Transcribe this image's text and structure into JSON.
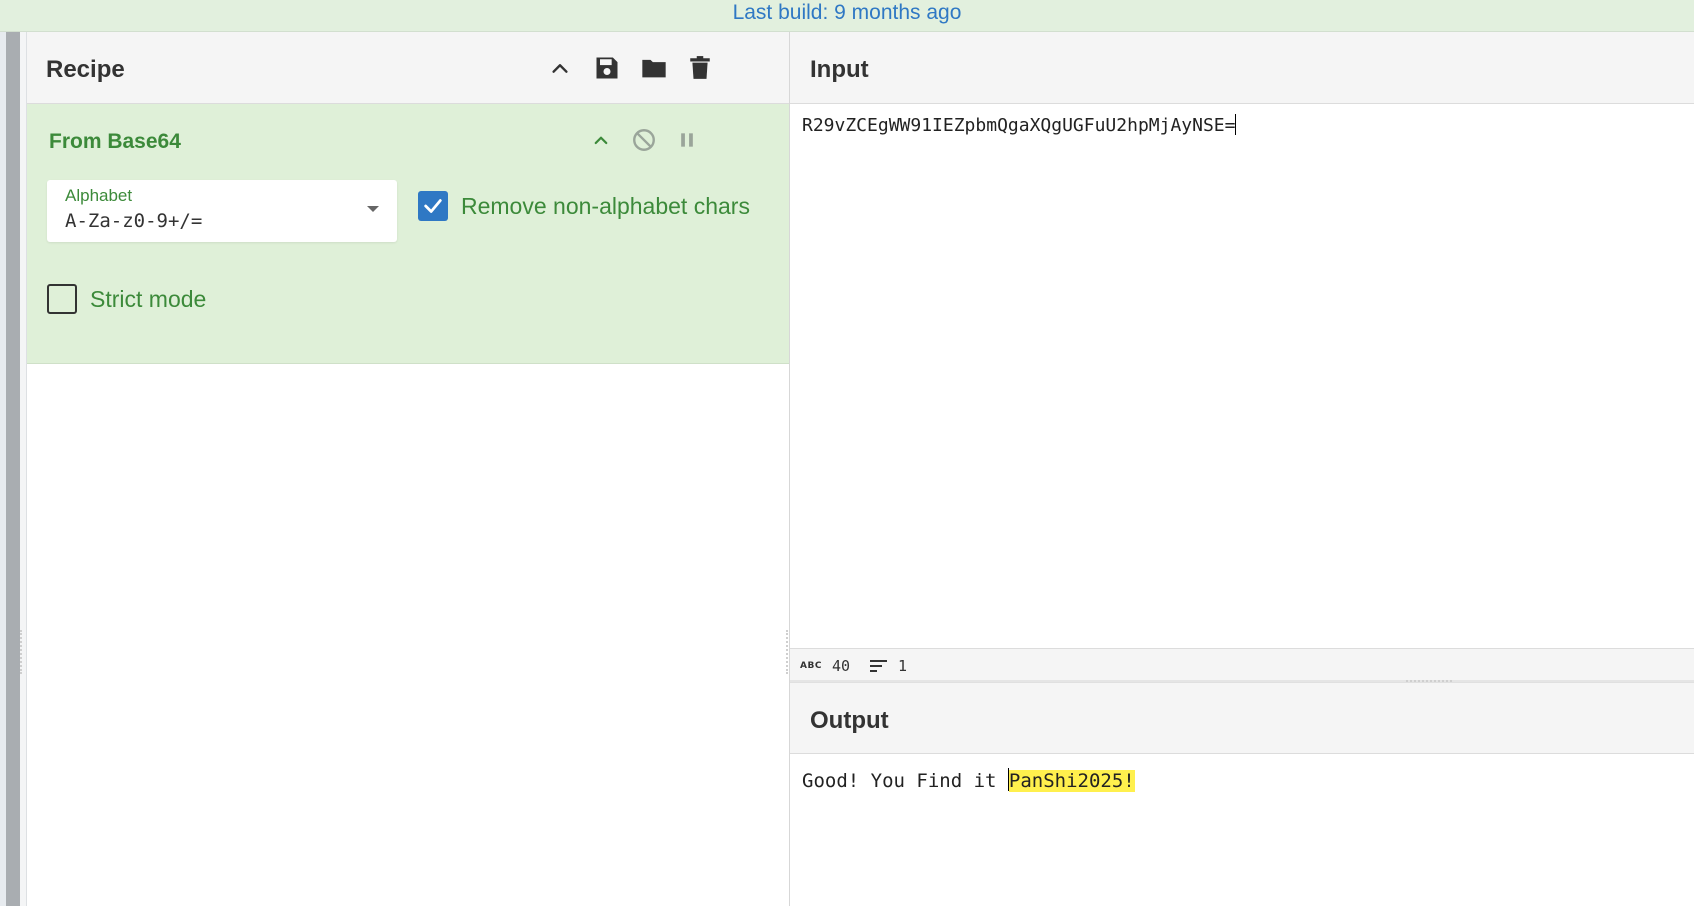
{
  "banner": {
    "text": "Last build: 9 months ago"
  },
  "recipe": {
    "title": "Recipe",
    "header_icons": [
      "chevron-up-icon",
      "save-icon",
      "folder-icon",
      "trash-icon"
    ],
    "operation": {
      "title": "From Base64",
      "controls": [
        "chevron-up-icon",
        "disable-icon",
        "pause-icon"
      ],
      "alphabet_label": "Alphabet",
      "alphabet_value": "A-Za-z0-9+/=",
      "remove_non_alphabet_label": "Remove non-alphabet chars",
      "remove_non_alphabet_checked": true,
      "strict_mode_label": "Strict mode",
      "strict_mode_checked": false
    }
  },
  "input": {
    "title": "Input",
    "value": "R29vZCEgWW91IEZpbmQgaXQgUGFuU2hpMjAyNSE=",
    "stats": {
      "chars": "40",
      "lines": "1"
    }
  },
  "output": {
    "title": "Output",
    "text_plain": "Good! You Find it ",
    "text_highlighted": "PanShi2025!"
  },
  "colors": {
    "banner_bg": "#e2f0de",
    "banner_text": "#2f78c4",
    "operation_bg": "#dff0d8",
    "operation_text": "#3c8a3a",
    "checkbox_accent": "#2f78c4",
    "highlight": "#fff04d"
  }
}
